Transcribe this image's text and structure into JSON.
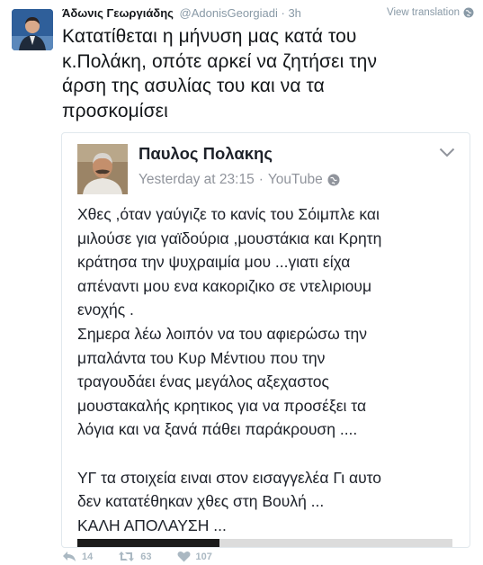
{
  "tweet": {
    "author_name": "Άδωνις Γεωργιάδης",
    "author_handle": "@AdonisGeorgiadi",
    "separator": "·",
    "time": "3h",
    "translate_label": "View translation",
    "text": "Κατατίθεται η μήνυση μας κατά του\nκ.Πολάκη, οπότε αρκεί να ζητήσει την\nάρση της ασυλίας του και να τα\nπροσκομίσει"
  },
  "embedded_post": {
    "author_name": "Παυλος Πολακης",
    "timestamp": "Yesterday at 23:15",
    "separator": "·",
    "source": "YouTube",
    "body": "Χθες ,όταν γαύγιζε το κανίς του Σόιμπλε και\nμιλούσε για γαϊδούρια ,μουστάκια και Κρητη\nκράτησα την ψυχραιμία μου ...γιατι είχα\nαπέναντι μου ενα κακοριζικο σε ντελιριουμ\nενοχής .\nΣημερα λέω λοιπόν να του αφιερώσω την\nμπαλάντα του Κυρ Μέντιου που την\nτραγουδάει ένας μεγάλος αξεχαστος\nμουστακαλής κρητικος για να προσέξει τα\nλόγια και να ξανά πάθει παράκρουση ....\n\nΥΓ τα στοιχεία ειναι στον εισαγγελέα Γι αυτο\nδεν κατατέθηκαν χθες στη Βουλή ...\nΚΑΛΗ ΑΠΟΛΑΥΣΗ ...",
    "video_progress_fraction": 0.38
  },
  "actions": {
    "reply_count": "14",
    "retweet_count": "63",
    "like_count": "107"
  },
  "colors": {
    "text": "#14171a",
    "muted": "#8899a6",
    "border": "#e1e8ed",
    "action_icon": "#aab8c2",
    "fb_text": "#1d2129",
    "fb_muted": "#90949c"
  },
  "icons": [
    "globe-icon",
    "chevron-down-icon",
    "reply-icon",
    "retweet-icon",
    "heart-icon"
  ]
}
